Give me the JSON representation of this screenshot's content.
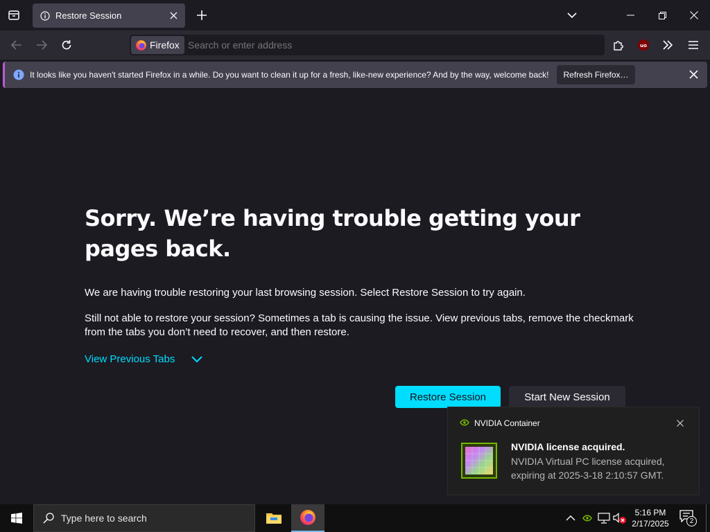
{
  "browser": {
    "tab_title": "Restore Session",
    "identity_label": "Firefox",
    "address_placeholder": "Search or enter address"
  },
  "notification_bar": {
    "message": "It looks like you haven't started Firefox in a while. Do you want to clean it up for a fresh, like-new experience? And by the way, welcome back!",
    "button_label": "Refresh Firefox…"
  },
  "page": {
    "heading": "Sorry. We’re having trouble getting your pages back.",
    "paragraph_1": "We are having trouble restoring your last browsing session. Select Restore Session to try again.",
    "paragraph_2": "Still not able to restore your session? Sometimes a tab is causing the issue. View previous tabs, remove the checkmark from the tabs you don’t need to recover, and then restore.",
    "view_previous_tabs": "View Previous Tabs",
    "restore_button": "Restore Session",
    "new_session_button": "Start New Session"
  },
  "toast": {
    "app_name": "NVIDIA Container",
    "title": "NVIDIA license acquired.",
    "body": "NVIDIA Virtual PC license acquired, expiring at 2025-3-18 2:10:57 GMT."
  },
  "taskbar": {
    "search_placeholder": "Type here to search",
    "time": "5:16 PM",
    "date": "2/17/2025",
    "notification_count": "2"
  },
  "colors": {
    "accent": "#00ddff",
    "browser_bg": "#1c1b22",
    "toolbar_bg": "#2b2a33",
    "nvidia_green": "#76b900"
  }
}
